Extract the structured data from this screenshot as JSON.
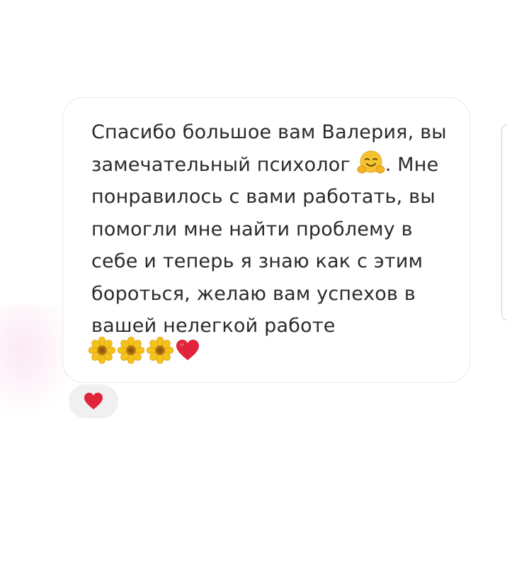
{
  "message": {
    "text_before_emoji": "Спасибо большое вам Валерия, вы замечательный психолог ",
    "text_after_emoji": ". Мне понравилось с вами работать, вы помогли мне найти проблему в себе и теперь я знаю как с этим бороться, желаю вам успехов в вашей нелегкой работе",
    "inline_emoji": "hugging-face-emoji",
    "trailing_emojis": [
      "sunflower-emoji",
      "sunflower-emoji",
      "sunflower-emoji",
      "red-heart-emoji"
    ]
  },
  "reaction": {
    "emoji": "red-heart-emoji"
  },
  "colors": {
    "heart": "#e0243a",
    "petal": "#f5c21b",
    "flower_center": "#b87a12",
    "bubble_border": "#e9e9e9",
    "reaction_bg": "#f0f0f0",
    "text": "#2a2a2a"
  }
}
